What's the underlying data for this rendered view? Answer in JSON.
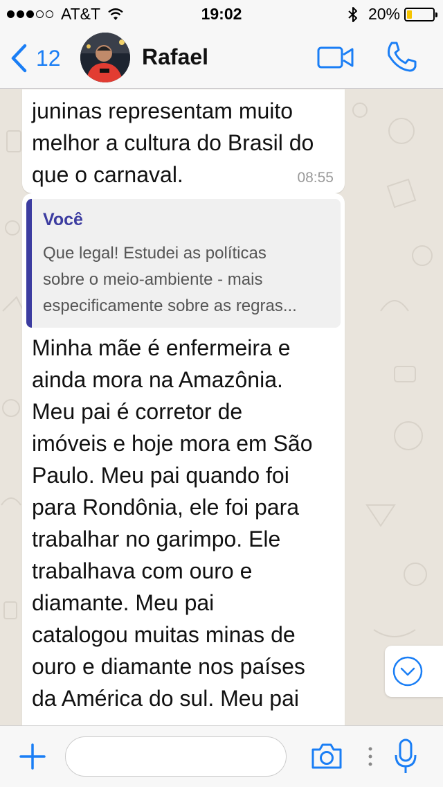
{
  "status_bar": {
    "carrier": "AT&T",
    "time": "19:02",
    "battery_percent": "20%",
    "battery_level": 0.2,
    "signal_bars_filled": 3,
    "signal_bars_total": 5
  },
  "nav": {
    "back_count": "12",
    "contact_name": "Rafael",
    "accent_color": "#1a7ef5"
  },
  "messages": [
    {
      "text": "juninas representam muito\nmelhor a cultura do Brasil do\nque o carnaval.",
      "time": "08:55"
    },
    {
      "quote": {
        "author": "Você",
        "text": "Que legal! Estudei as políticas\nsobre o meio-ambiente - mais\nespecificamente sobre as regras..."
      },
      "text": "Minha mãe é enfermeira e\nainda mora na Amazônia.\nMeu pai é corretor de\nimóveis e hoje mora em São\nPaulo. Meu pai quando foi\npara Rondônia, ele foi para\ntrabalhar no garimpo. Ele\ntrabalhava com ouro e\ndiamante. Meu pai\ncatalogou muitas minas de\nouro e diamante nos países\nda América do sul.  Meu pai"
    }
  ],
  "input": {
    "placeholder": ""
  },
  "icons": {
    "back": "chevron-left-icon",
    "video": "video-camera-icon",
    "call": "phone-icon",
    "scroll_down": "chevron-down-circle-icon",
    "attach": "plus-icon",
    "camera": "camera-icon",
    "mic": "microphone-icon"
  }
}
